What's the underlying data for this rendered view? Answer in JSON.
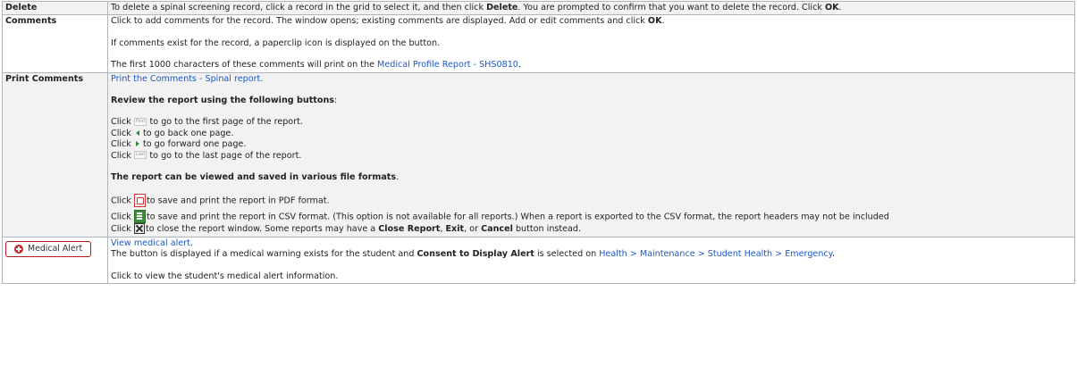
{
  "rows": {
    "delete": {
      "label": "Delete",
      "t1": "To delete a spinal screening record, click a record in the grid to select it, and then click ",
      "b1": "Delete",
      "t2": ". You are prompted to confirm that you want to delete the record. Click ",
      "b2": "OK",
      "t3": "."
    },
    "comments": {
      "label": "Comments",
      "p1_t1": "Click to add comments for the record. The window opens; existing comments are displayed. Add or edit comments and click ",
      "p1_b1": "OK",
      "p1_t2": ".",
      "p2": "If comments exist for the record, a paperclip icon is displayed on the button.",
      "p3_t1": "The first 1000 characters of these comments will print on the ",
      "p3_link": "Medical Profile Report - SHS0810",
      "p3_t2": "."
    },
    "print": {
      "label": "Print Comments",
      "link": "Print the Comments - Spinal report.",
      "review_bold": "Review the report using the following buttons",
      "review_colon": ":",
      "first_btn": "First",
      "last_btn": "Last",
      "click": "Click",
      "first_text": " to go to the first page of the report.",
      "prev_text": "to go back one page.",
      "next_text": "to go forward one page.",
      "last_text": " to go to the last page of the report.",
      "formats_bold": "The report can be viewed and saved in various file formats",
      "formats_period": ".",
      "pdf_text": "to save and print the report in PDF format.",
      "csv_text": "to save and print the report in CSV format. (This option is not available for all reports.) When a report is exported to the CSV format, the report headers may not be included",
      "close_t1": "to close the report window. Some reports may have a ",
      "close_b1": "Close Report",
      "close_t2": ", ",
      "close_b2": "Exit",
      "close_t3": ", or ",
      "close_b3": "Cancel",
      "close_t4": " button instead."
    },
    "alert": {
      "button_label": "Medical Alert",
      "link": "View medical alert.",
      "t1": "The button is displayed if a medical warning exists for the student and ",
      "b1": "Consent to Display Alert",
      "t2": " is selected on ",
      "link2": "Health > Maintenance > Student Health > Emergency",
      "t3": ".",
      "last_line": "Click to view the student's medical alert information."
    }
  },
  "icons": {
    "pdf": "pdf-icon",
    "csv": "csv-icon",
    "close": "close-report-icon",
    "prev": "previous-page-icon",
    "next": "next-page-icon",
    "alert": "plus-circle-icon"
  },
  "colors": {
    "link": "#1f57c5",
    "border": "#aeb5bd",
    "alt_row": "#f2f2f2",
    "alert_red": "#c8282d"
  }
}
